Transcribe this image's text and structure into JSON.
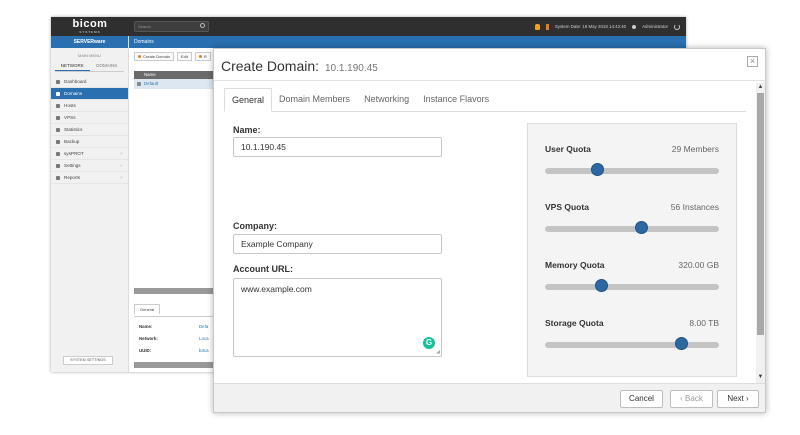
{
  "app": {
    "logo": "bicom",
    "logo_sub": "SYSTEMS",
    "search_placeholder": "Search",
    "system_date": "System Date: 18 May 2018 14:42:40",
    "user": "Administrator",
    "brand": "SERVERware",
    "breadcrumb": "Domains",
    "menu_title": "MAIN MENU",
    "menu_tabs": [
      "NETWORK",
      "DOMAINS"
    ],
    "menu_items": [
      {
        "label": "Dashboard",
        "icon": "dashboard-icon"
      },
      {
        "label": "Domains",
        "icon": "domains-icon"
      },
      {
        "label": "Hosts",
        "icon": "hosts-icon"
      },
      {
        "label": "VPSs",
        "icon": "vps-icon"
      },
      {
        "label": "Statistics",
        "icon": "statistics-icon"
      },
      {
        "label": "Backup",
        "icon": "backup-icon"
      },
      {
        "label": "sysPROT",
        "icon": "shield-icon",
        "chevron": "›"
      },
      {
        "label": "Settings",
        "icon": "gear-icon",
        "chevron": "›"
      },
      {
        "label": "Reports",
        "icon": "reports-icon",
        "chevron": "›"
      }
    ],
    "system_settings": "SYSTEM SETTINGS",
    "toolbar": {
      "create": "Create Domain",
      "edit": "Edit",
      "more": "R"
    },
    "table": {
      "header": "Name",
      "row": "Default"
    },
    "detail": {
      "tab": "General",
      "rows": [
        {
          "key": "Name:",
          "value": "Defa"
        },
        {
          "key": "Network:",
          "value": "Loca"
        },
        {
          "key": "UUID:",
          "value": "b3ca"
        }
      ]
    }
  },
  "modal": {
    "title": "Create Domain:",
    "subtitle": "10.1.190.45",
    "close": "×",
    "tabs": [
      "General",
      "Domain Members",
      "Networking",
      "Instance Flavors"
    ],
    "active_tab": "General",
    "fields": {
      "name_label": "Name:",
      "name_value": "10.1.190.45",
      "company_label": "Company:",
      "company_value": "Example Company",
      "url_label": "Account URL:",
      "url_value": "www.example.com",
      "grammarly": "G"
    },
    "quotas": [
      {
        "name": "User Quota",
        "value": "29 Members",
        "level": 0.3
      },
      {
        "name": "VPS Quota",
        "value": "56 Instances",
        "level": 0.55
      },
      {
        "name": "Memory Quota",
        "value": "320.00 GB",
        "level": 0.32
      },
      {
        "name": "Storage Quota",
        "value": "8.00 TB",
        "level": 0.78
      }
    ],
    "buttons": {
      "cancel": "Cancel",
      "back": "‹ Back",
      "next": "Next ›"
    }
  },
  "colors": {
    "accent": "#2a6fb0",
    "slider": "#2c69a3"
  }
}
